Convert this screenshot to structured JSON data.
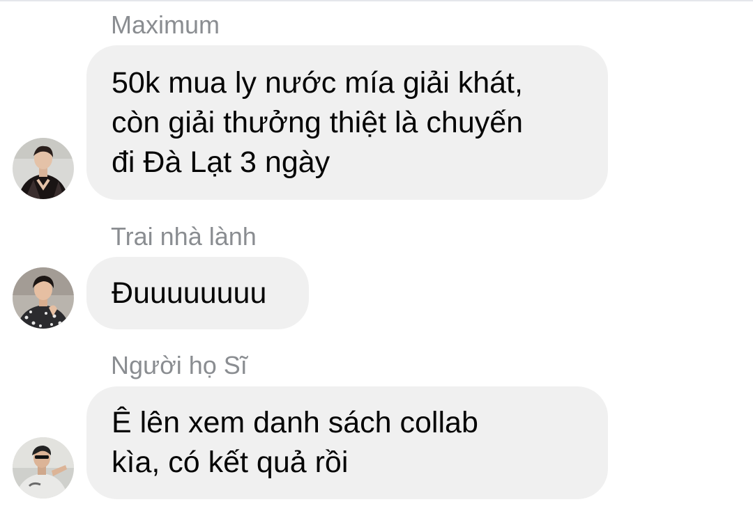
{
  "messages": [
    {
      "sender": "Maximum",
      "lines": [
        "50k mua ly nước mía giải khát,",
        "còn giải thưởng thiệt là chuyến",
        "đi Đà Lạt 3 ngày"
      ],
      "avatar_icon": "user-avatar-icon"
    },
    {
      "sender": "Trai nhà lành",
      "lines": [
        "Đuuuuuuuu"
      ],
      "avatar_icon": "user-avatar-icon"
    },
    {
      "sender": "Người họ Sĩ",
      "lines": [
        "Ê lên xem danh sách collab",
        "kìa, có kết quả rồi"
      ],
      "avatar_icon": "user-avatar-icon"
    }
  ],
  "colors": {
    "bubble_bg": "#f0f0f0",
    "sender_text": "#8a8d91",
    "message_text": "#050505",
    "divider": "#e4e6eb"
  }
}
